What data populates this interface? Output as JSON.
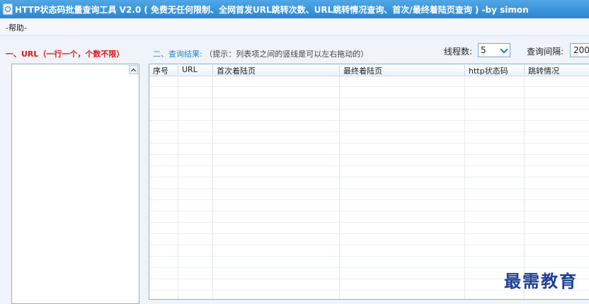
{
  "window": {
    "title": "HTTP状态码批量查询工具 V2.0 ( 免费无任何限制、全网首发URL跳转次数、URL跳转情况查询、首次/最终着陆页查询 ) -by simon"
  },
  "menu": {
    "help_label": "-帮助-"
  },
  "sections": {
    "url_label": "一、URL（一行一个，个数不限）",
    "results_label": "二、查询结果:",
    "results_hint": "（提示：列表项之间的竖线是可以左右拖动的）"
  },
  "controls": {
    "threads_label": "线程数:",
    "threads_value": "5",
    "interval_label": "查询间隔:",
    "interval_value": "200"
  },
  "table": {
    "columns": [
      "序号",
      "URL",
      "首次着陆页",
      "最终着陆页",
      "http状态码",
      "跳转情况"
    ]
  },
  "watermark": "最需教育",
  "colors": {
    "titlebar": "#2a86d1",
    "url_label": "#e61414",
    "results_label": "#1a86d6"
  }
}
